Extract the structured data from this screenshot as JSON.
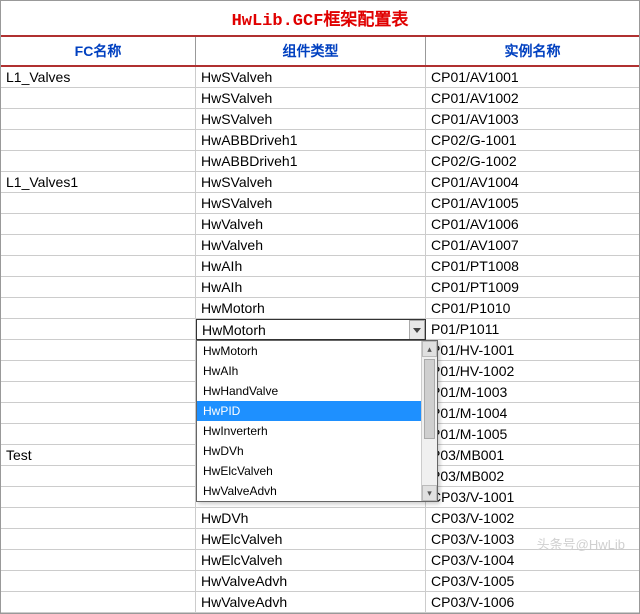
{
  "title": "HwLib.GCF框架配置表",
  "headers": {
    "fc": "FC名称",
    "comp": "组件类型",
    "inst": "实例名称"
  },
  "rows_before": [
    {
      "fc": "L1_Valves",
      "comp": "HwSValveh",
      "inst": "CP01/AV1001"
    },
    {
      "fc": "",
      "comp": "HwSValveh",
      "inst": "CP01/AV1002"
    },
    {
      "fc": "",
      "comp": "HwSValveh",
      "inst": "CP01/AV1003"
    },
    {
      "fc": "",
      "comp": "HwABBDriveh1",
      "inst": "CP02/G-1001"
    },
    {
      "fc": "",
      "comp": "HwABBDriveh1",
      "inst": "CP02/G-1002"
    },
    {
      "fc": "L1_Valves1",
      "comp": "HwSValveh",
      "inst": "CP01/AV1004"
    },
    {
      "fc": "",
      "comp": "HwSValveh",
      "inst": "CP01/AV1005"
    },
    {
      "fc": "",
      "comp": "HwValveh",
      "inst": "CP01/AV1006"
    },
    {
      "fc": "",
      "comp": "HwValveh",
      "inst": "CP01/AV1007"
    },
    {
      "fc": "",
      "comp": "HwAIh",
      "inst": "CP01/PT1008"
    },
    {
      "fc": "",
      "comp": "HwAIh",
      "inst": "CP01/PT1009"
    },
    {
      "fc": "",
      "comp": "HwMotorh",
      "inst": "CP01/P1010"
    }
  ],
  "active_row": {
    "fc": "",
    "comp": "HwMotorh",
    "inst": "P01/P1011"
  },
  "dropdown": {
    "items": [
      "HwMotorh",
      "HwAIh",
      "HwHandValve",
      "HwPID",
      "HwInverterh",
      "HwDVh",
      "HwElcValveh",
      "HwValveAdvh"
    ],
    "selected_index": 3
  },
  "rows_obscured": [
    {
      "inst": "P01/HV-1001"
    },
    {
      "inst": "P01/HV-1002"
    },
    {
      "inst": "P01/M-1003"
    },
    {
      "inst": "P01/M-1004"
    },
    {
      "inst": "P01/M-1005"
    },
    {
      "inst": "P03/MB001"
    },
    {
      "inst": "P03/MB002"
    }
  ],
  "obscured_fc": {
    "5": "Test"
  },
  "rows_after": [
    {
      "fc": "",
      "comp": "HwDVh",
      "inst": "CP03/V-1001"
    },
    {
      "fc": "",
      "comp": "HwDVh",
      "inst": "CP03/V-1002"
    },
    {
      "fc": "",
      "comp": "HwElcValveh",
      "inst": "CP03/V-1003"
    },
    {
      "fc": "",
      "comp": "HwElcValveh",
      "inst": "CP03/V-1004"
    },
    {
      "fc": "",
      "comp": "HwValveAdvh",
      "inst": "CP03/V-1005"
    },
    {
      "fc": "",
      "comp": "HwValveAdvh",
      "inst": "CP03/V-1006"
    }
  ],
  "watermark": "头条号@HwLib"
}
